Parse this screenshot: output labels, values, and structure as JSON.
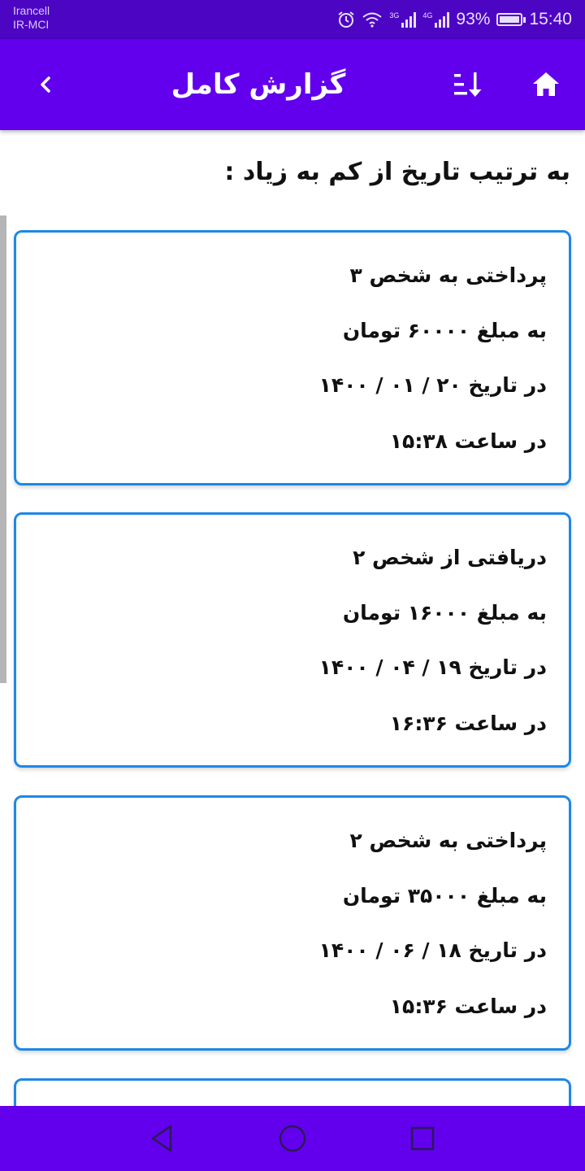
{
  "status_bar": {
    "carrier_line1": "Irancell",
    "carrier_line2": "IR-MCI",
    "net1": "3G",
    "net2": "4G",
    "battery": "93%",
    "time": "15:40"
  },
  "app_bar": {
    "title": "گزارش کامل",
    "icons": [
      "chevron-left-icon",
      "sort-icon",
      "home-icon"
    ],
    "color": "#6200ee"
  },
  "sort_heading": "به ترتیب تاریخ از کم به زیاد :",
  "transactions": [
    {
      "type": "پرداختی به شخص ۳",
      "amount": "به مبلغ ۶۰۰۰۰ تومان",
      "date": "در تاریخ ۲۰ / ۰۱ / ۱۴۰۰",
      "time": "در ساعت ۱۵:۳۸"
    },
    {
      "type": "دریافتی از شخص ۲",
      "amount": "به مبلغ ۱۶۰۰۰ تومان",
      "date": "در تاریخ ۱۹ / ۰۴ / ۱۴۰۰",
      "time": "در ساعت ۱۶:۳۶"
    },
    {
      "type": "پرداختی به شخص ۲",
      "amount": "به مبلغ ۳۵۰۰۰ تومان",
      "date": "در تاریخ ۱۸ / ۰۶ / ۱۴۰۰",
      "time": "در ساعت ۱۵:۳۶"
    }
  ],
  "card_border_color": "#1e88e5",
  "nav_bar": {
    "icons": [
      "back-triangle-icon",
      "home-circle-icon",
      "recents-square-icon"
    ]
  }
}
